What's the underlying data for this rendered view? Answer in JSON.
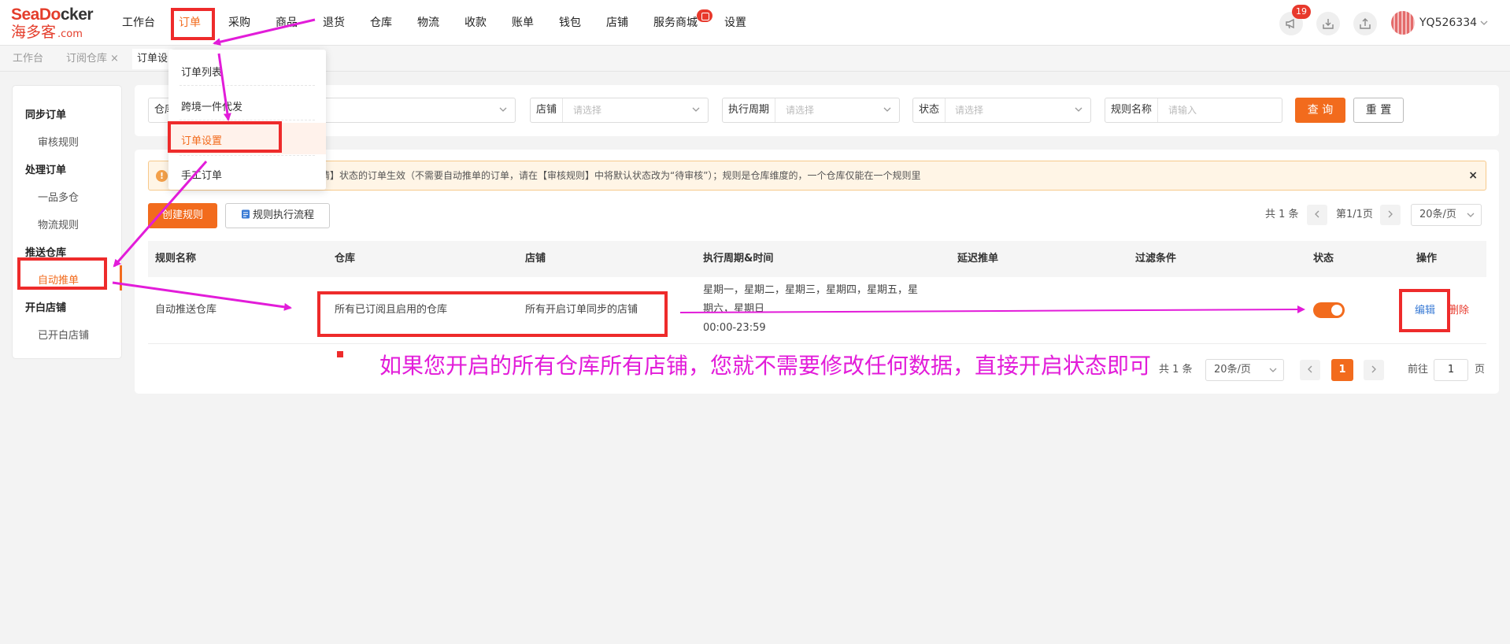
{
  "brand": {
    "logo_en_a": "SeaDo",
    "logo_en_b": "cker",
    "logo_cn": "海多客",
    "logo_domain": ".com",
    "accent": "#f26b1d"
  },
  "nav": {
    "items": [
      "工作台",
      "订单",
      "采购",
      "商品",
      "退货",
      "仓库",
      "物流",
      "收款",
      "账单",
      "钱包",
      "店铺",
      "服务商城",
      "设置"
    ],
    "active": "订单"
  },
  "header": {
    "notification_count": "19",
    "username": "YQ526334"
  },
  "tabs": [
    {
      "label": "工作台"
    },
    {
      "label": "订阅仓库",
      "close": "×"
    },
    {
      "label": "订单设"
    }
  ],
  "dropdown": {
    "items": [
      "订单列表",
      "跨境一件代发",
      "订单设置",
      "手工订单"
    ],
    "active": "订单设置"
  },
  "sidebar": {
    "groups": [
      {
        "label": "同步订单",
        "items": [
          "审核规则"
        ]
      },
      {
        "label": "处理订单",
        "items": [
          "一品多仓",
          "物流规则"
        ]
      },
      {
        "label": "推送仓库",
        "items": [
          "自动推单"
        ]
      },
      {
        "label": "开白店铺",
        "items": [
          "已开白店铺"
        ]
      }
    ],
    "active": "自动推单"
  },
  "filters": {
    "warehouse_label": "仓库",
    "shop": {
      "label": "店铺",
      "placeholder": "请选择"
    },
    "cycle": {
      "label": "执行周期",
      "placeholder": "请选择"
    },
    "status": {
      "label": "状态",
      "placeholder": "请选择"
    },
    "rule_name": {
      "label": "规则名称",
      "placeholder": "请输入"
    },
    "query_button": "查 询",
    "reset_button": "重 置"
  },
  "notice": {
    "text": "申请】状态的订单生效（不需要自动推单的订单，请在【审核规则】中将默认状态改为“待审核”）；规则是仓库维度的，一个仓库仅能在一个规则里",
    "close": "×"
  },
  "toolbar": {
    "create_button": "创建规则",
    "flow_button": "规则执行流程",
    "total_text": "共 1 条",
    "page_text": "第1/1页",
    "page_size": "20条/页"
  },
  "table": {
    "columns": [
      "规则名称",
      "仓库",
      "店铺",
      "执行周期&时间",
      "延迟推单",
      "过滤条件",
      "状态",
      "操作"
    ],
    "rows": [
      {
        "rule_name": "自动推送仓库",
        "warehouse": "所有已订阅且启用的仓库",
        "shop": "所有开启订单同步的店铺",
        "cycle_line1": "星期一，星期二，星期三，星期四，星期五，星",
        "cycle_line2": "期六，星期日",
        "time": "00:00-23:59",
        "status_on": true,
        "edit": "编辑",
        "delete": "删除"
      }
    ]
  },
  "footer_pager": {
    "total_text": "共 1 条",
    "page_size": "20条/页",
    "current_page": "1",
    "goto_label": "前往",
    "goto_value": "1",
    "page_unit": "页"
  },
  "annotation": {
    "text": "如果您开启的所有仓库所有店铺，您就不需要修改任何数据，直接开启状态即可",
    "color": "#e21cd9",
    "box_color": "#ee2b2b"
  }
}
